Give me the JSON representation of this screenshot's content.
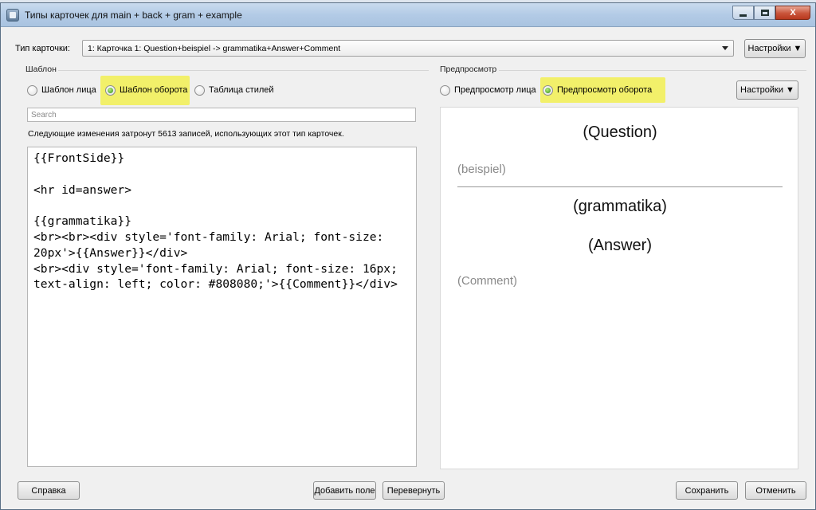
{
  "window": {
    "title": "Типы карточек для main + back + gram + example",
    "minimize_icon": "minimize-icon",
    "maximize_icon": "maximize-icon",
    "close_icon": "close-icon",
    "close_glyph": "X"
  },
  "card_type": {
    "label": "Тип карточки:",
    "selected": "1: Карточка 1: Question+beispiel -> grammatika+Answer+Comment",
    "settings_button": "Настройки ▼"
  },
  "template": {
    "group_title": "Шаблон",
    "radios": [
      {
        "label": "Шаблон лица",
        "checked": false
      },
      {
        "label": "Шаблон оборота",
        "checked": true
      },
      {
        "label": "Таблица стилей",
        "checked": false
      }
    ],
    "search_placeholder": "Search",
    "note": "Следующие изменения затронут 5613 записей, использующих этот тип карточек.",
    "code": "{{FrontSide}}\n\n<hr id=answer>\n\n{{grammatika}}\n<br><br><div style='font-family: Arial; font-size: 20px'>{{Answer}}</div>\n<br><div style='font-family: Arial; font-size: 16px;  text-align: left; color: #808080;'>{{Comment}}</div>"
  },
  "preview": {
    "group_title": "Предпросмотр",
    "radios": [
      {
        "label": "Предпросмотр лица",
        "checked": false
      },
      {
        "label": "Предпросмотр оборота",
        "checked": true
      }
    ],
    "settings_button": "Настройки ▼",
    "question": "(Question)",
    "beispiel": "(beispiel)",
    "grammatika": "(grammatika)",
    "answer": "(Answer)",
    "comment": "(Comment)"
  },
  "footer": {
    "help": "Справка",
    "add_field": "Добавить поле",
    "flip": "Перевернуть",
    "save": "Сохранить",
    "cancel": "Отменить"
  },
  "colors": {
    "highlight": "#f2f06a",
    "radio_checked": "#2e8a13",
    "comment_text": "#808080"
  }
}
